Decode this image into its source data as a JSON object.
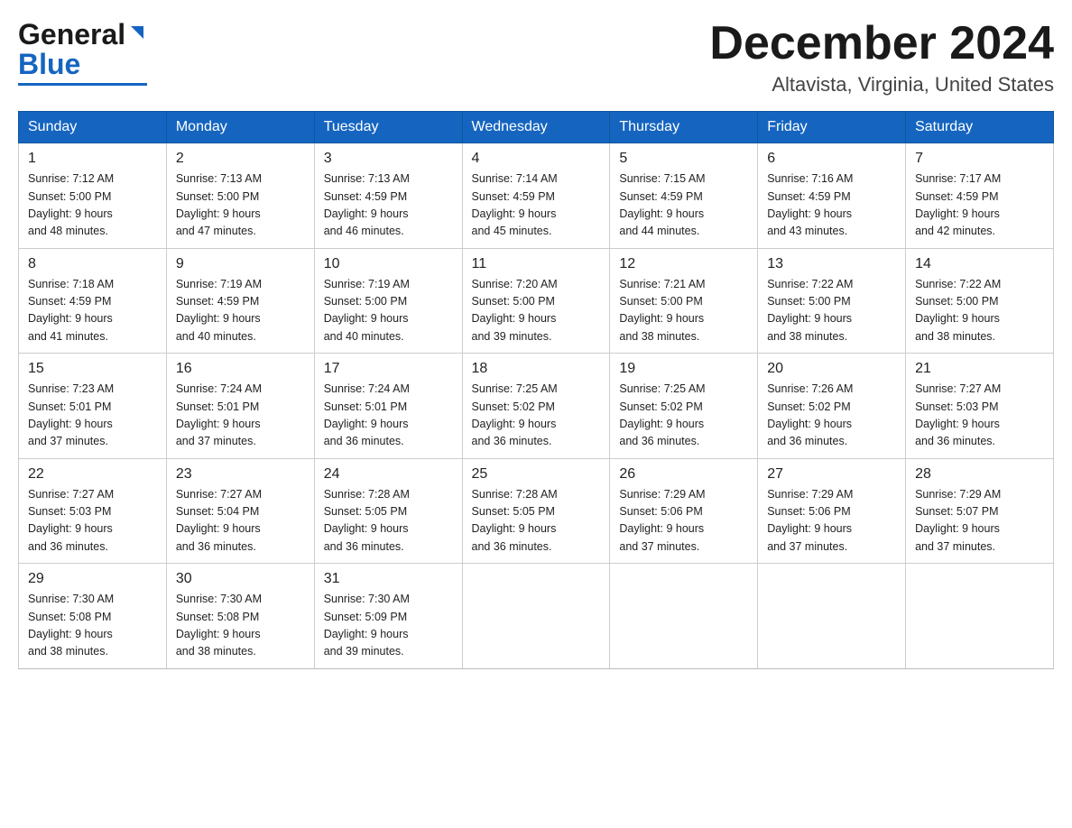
{
  "header": {
    "logo_general": "General",
    "logo_blue": "Blue",
    "month_title": "December 2024",
    "location": "Altavista, Virginia, United States"
  },
  "weekdays": [
    "Sunday",
    "Monday",
    "Tuesday",
    "Wednesday",
    "Thursday",
    "Friday",
    "Saturday"
  ],
  "weeks": [
    [
      {
        "day": "1",
        "sunrise": "7:12 AM",
        "sunset": "5:00 PM",
        "daylight": "9 hours and 48 minutes."
      },
      {
        "day": "2",
        "sunrise": "7:13 AM",
        "sunset": "5:00 PM",
        "daylight": "9 hours and 47 minutes."
      },
      {
        "day": "3",
        "sunrise": "7:13 AM",
        "sunset": "4:59 PM",
        "daylight": "9 hours and 46 minutes."
      },
      {
        "day": "4",
        "sunrise": "7:14 AM",
        "sunset": "4:59 PM",
        "daylight": "9 hours and 45 minutes."
      },
      {
        "day": "5",
        "sunrise": "7:15 AM",
        "sunset": "4:59 PM",
        "daylight": "9 hours and 44 minutes."
      },
      {
        "day": "6",
        "sunrise": "7:16 AM",
        "sunset": "4:59 PM",
        "daylight": "9 hours and 43 minutes."
      },
      {
        "day": "7",
        "sunrise": "7:17 AM",
        "sunset": "4:59 PM",
        "daylight": "9 hours and 42 minutes."
      }
    ],
    [
      {
        "day": "8",
        "sunrise": "7:18 AM",
        "sunset": "4:59 PM",
        "daylight": "9 hours and 41 minutes."
      },
      {
        "day": "9",
        "sunrise": "7:19 AM",
        "sunset": "4:59 PM",
        "daylight": "9 hours and 40 minutes."
      },
      {
        "day": "10",
        "sunrise": "7:19 AM",
        "sunset": "5:00 PM",
        "daylight": "9 hours and 40 minutes."
      },
      {
        "day": "11",
        "sunrise": "7:20 AM",
        "sunset": "5:00 PM",
        "daylight": "9 hours and 39 minutes."
      },
      {
        "day": "12",
        "sunrise": "7:21 AM",
        "sunset": "5:00 PM",
        "daylight": "9 hours and 38 minutes."
      },
      {
        "day": "13",
        "sunrise": "7:22 AM",
        "sunset": "5:00 PM",
        "daylight": "9 hours and 38 minutes."
      },
      {
        "day": "14",
        "sunrise": "7:22 AM",
        "sunset": "5:00 PM",
        "daylight": "9 hours and 38 minutes."
      }
    ],
    [
      {
        "day": "15",
        "sunrise": "7:23 AM",
        "sunset": "5:01 PM",
        "daylight": "9 hours and 37 minutes."
      },
      {
        "day": "16",
        "sunrise": "7:24 AM",
        "sunset": "5:01 PM",
        "daylight": "9 hours and 37 minutes."
      },
      {
        "day": "17",
        "sunrise": "7:24 AM",
        "sunset": "5:01 PM",
        "daylight": "9 hours and 36 minutes."
      },
      {
        "day": "18",
        "sunrise": "7:25 AM",
        "sunset": "5:02 PM",
        "daylight": "9 hours and 36 minutes."
      },
      {
        "day": "19",
        "sunrise": "7:25 AM",
        "sunset": "5:02 PM",
        "daylight": "9 hours and 36 minutes."
      },
      {
        "day": "20",
        "sunrise": "7:26 AM",
        "sunset": "5:02 PM",
        "daylight": "9 hours and 36 minutes."
      },
      {
        "day": "21",
        "sunrise": "7:27 AM",
        "sunset": "5:03 PM",
        "daylight": "9 hours and 36 minutes."
      }
    ],
    [
      {
        "day": "22",
        "sunrise": "7:27 AM",
        "sunset": "5:03 PM",
        "daylight": "9 hours and 36 minutes."
      },
      {
        "day": "23",
        "sunrise": "7:27 AM",
        "sunset": "5:04 PM",
        "daylight": "9 hours and 36 minutes."
      },
      {
        "day": "24",
        "sunrise": "7:28 AM",
        "sunset": "5:05 PM",
        "daylight": "9 hours and 36 minutes."
      },
      {
        "day": "25",
        "sunrise": "7:28 AM",
        "sunset": "5:05 PM",
        "daylight": "9 hours and 36 minutes."
      },
      {
        "day": "26",
        "sunrise": "7:29 AM",
        "sunset": "5:06 PM",
        "daylight": "9 hours and 37 minutes."
      },
      {
        "day": "27",
        "sunrise": "7:29 AM",
        "sunset": "5:06 PM",
        "daylight": "9 hours and 37 minutes."
      },
      {
        "day": "28",
        "sunrise": "7:29 AM",
        "sunset": "5:07 PM",
        "daylight": "9 hours and 37 minutes."
      }
    ],
    [
      {
        "day": "29",
        "sunrise": "7:30 AM",
        "sunset": "5:08 PM",
        "daylight": "9 hours and 38 minutes."
      },
      {
        "day": "30",
        "sunrise": "7:30 AM",
        "sunset": "5:08 PM",
        "daylight": "9 hours and 38 minutes."
      },
      {
        "day": "31",
        "sunrise": "7:30 AM",
        "sunset": "5:09 PM",
        "daylight": "9 hours and 39 minutes."
      },
      null,
      null,
      null,
      null
    ]
  ],
  "labels": {
    "sunrise_prefix": "Sunrise: ",
    "sunset_prefix": "Sunset: ",
    "daylight_prefix": "Daylight: "
  }
}
